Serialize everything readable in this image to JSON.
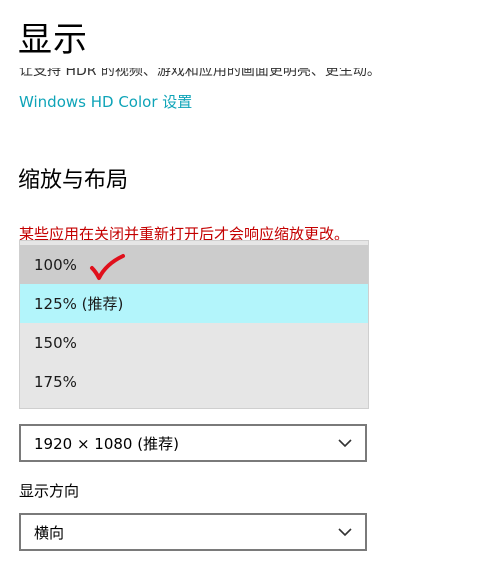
{
  "header": {
    "title": "显示"
  },
  "hdr": {
    "description_fragment": "让支持 HDR 的视频、游戏和应用的画面更明亮、更生动。",
    "link_label": "Windows HD Color 设置"
  },
  "scale_layout": {
    "heading": "缩放与布局",
    "warning": "某些应用在关闭并重新打开后才会响应缩放更改。",
    "scale_options": [
      {
        "label": "100%",
        "state": "current"
      },
      {
        "label": "125% (推荐)",
        "state": "hover"
      },
      {
        "label": "150%",
        "state": "normal"
      },
      {
        "label": "175%",
        "state": "normal"
      }
    ],
    "annotation": {
      "icon": "red-checkmark",
      "color": "#e0101c"
    },
    "resolution": {
      "value": "1920 × 1080 (推荐)",
      "icon": "chevron-down-icon"
    },
    "orientation": {
      "label": "显示方向",
      "value": "横向",
      "icon": "chevron-down-icon"
    }
  },
  "colors": {
    "link": "#0fa4b8",
    "warning": "#c40000",
    "hover_option": "#b3f5fb",
    "current_option": "#cccccc"
  }
}
